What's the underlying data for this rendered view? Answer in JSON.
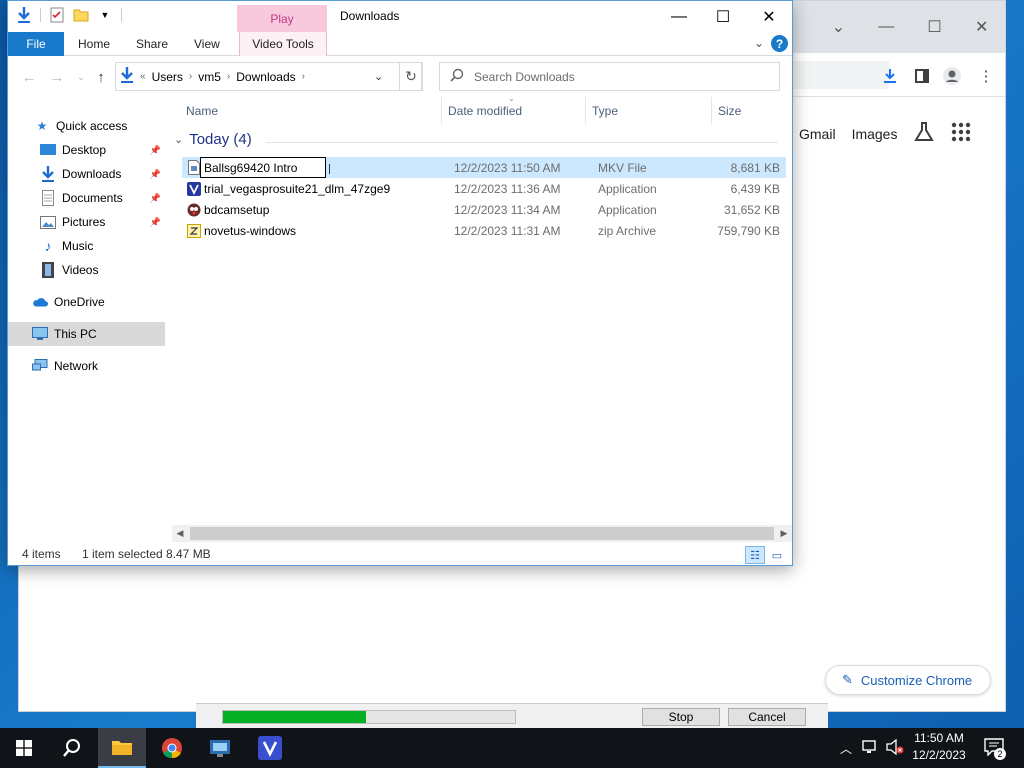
{
  "chrome": {
    "links": [
      "Gmail",
      "Images"
    ],
    "customize_label": "Customize Chrome"
  },
  "download_dialog": {
    "progress": 0.49,
    "stop_label": "Stop",
    "cancel_label": "Cancel"
  },
  "explorer": {
    "title": "Downloads",
    "contextual_tab_group": "Play",
    "ribbon_tabs": [
      "File",
      "Home",
      "Share",
      "View",
      "Video Tools"
    ],
    "address": {
      "overflow": "«",
      "segments": [
        "Users",
        "vm5",
        "Downloads"
      ]
    },
    "search_placeholder": "Search Downloads",
    "nav": [
      {
        "label": "Quick access",
        "icon": "star-icon"
      },
      {
        "label": "Desktop",
        "icon": "desktop-icon",
        "pinned": true
      },
      {
        "label": "Downloads",
        "icon": "download-arrow-icon",
        "pinned": true
      },
      {
        "label": "Documents",
        "icon": "document-icon",
        "pinned": true
      },
      {
        "label": "Pictures",
        "icon": "picture-icon",
        "pinned": true
      },
      {
        "label": "Music",
        "icon": "music-note-icon"
      },
      {
        "label": "Videos",
        "icon": "film-icon"
      },
      {
        "label": "OneDrive",
        "icon": "cloud-icon"
      },
      {
        "label": "This PC",
        "icon": "computer-icon",
        "selected": true
      },
      {
        "label": "Network",
        "icon": "network-icon"
      }
    ],
    "columns": [
      "Name",
      "Date modified",
      "Type",
      "Size"
    ],
    "group_label": "Today (4)",
    "files": [
      {
        "name": "Ballsg69420 Intro",
        "date": "12/2/2023 11:50 AM",
        "type": "MKV File",
        "size": "8,681 KB",
        "icon": "video-file-icon",
        "selected": true,
        "renaming": true
      },
      {
        "name": "trial_vegasprosuite21_dlm_47zge9",
        "date": "12/2/2023 11:36 AM",
        "type": "Application",
        "size": "6,439 KB",
        "icon": "vegas-app-icon"
      },
      {
        "name": "bdcamsetup",
        "date": "12/2/2023 11:34 AM",
        "type": "Application",
        "size": "31,652 KB",
        "icon": "bandicam-icon"
      },
      {
        "name": "novetus-windows",
        "date": "12/2/2023 11:31 AM",
        "type": "zip Archive",
        "size": "759,790 KB",
        "icon": "zip-file-icon"
      }
    ],
    "status": {
      "items": "4 items",
      "selection": "1 item selected",
      "selection_size": "8.47 MB"
    }
  },
  "taskbar": {
    "time": "11:50 AM",
    "date": "12/2/2023",
    "notification_count": "2"
  }
}
